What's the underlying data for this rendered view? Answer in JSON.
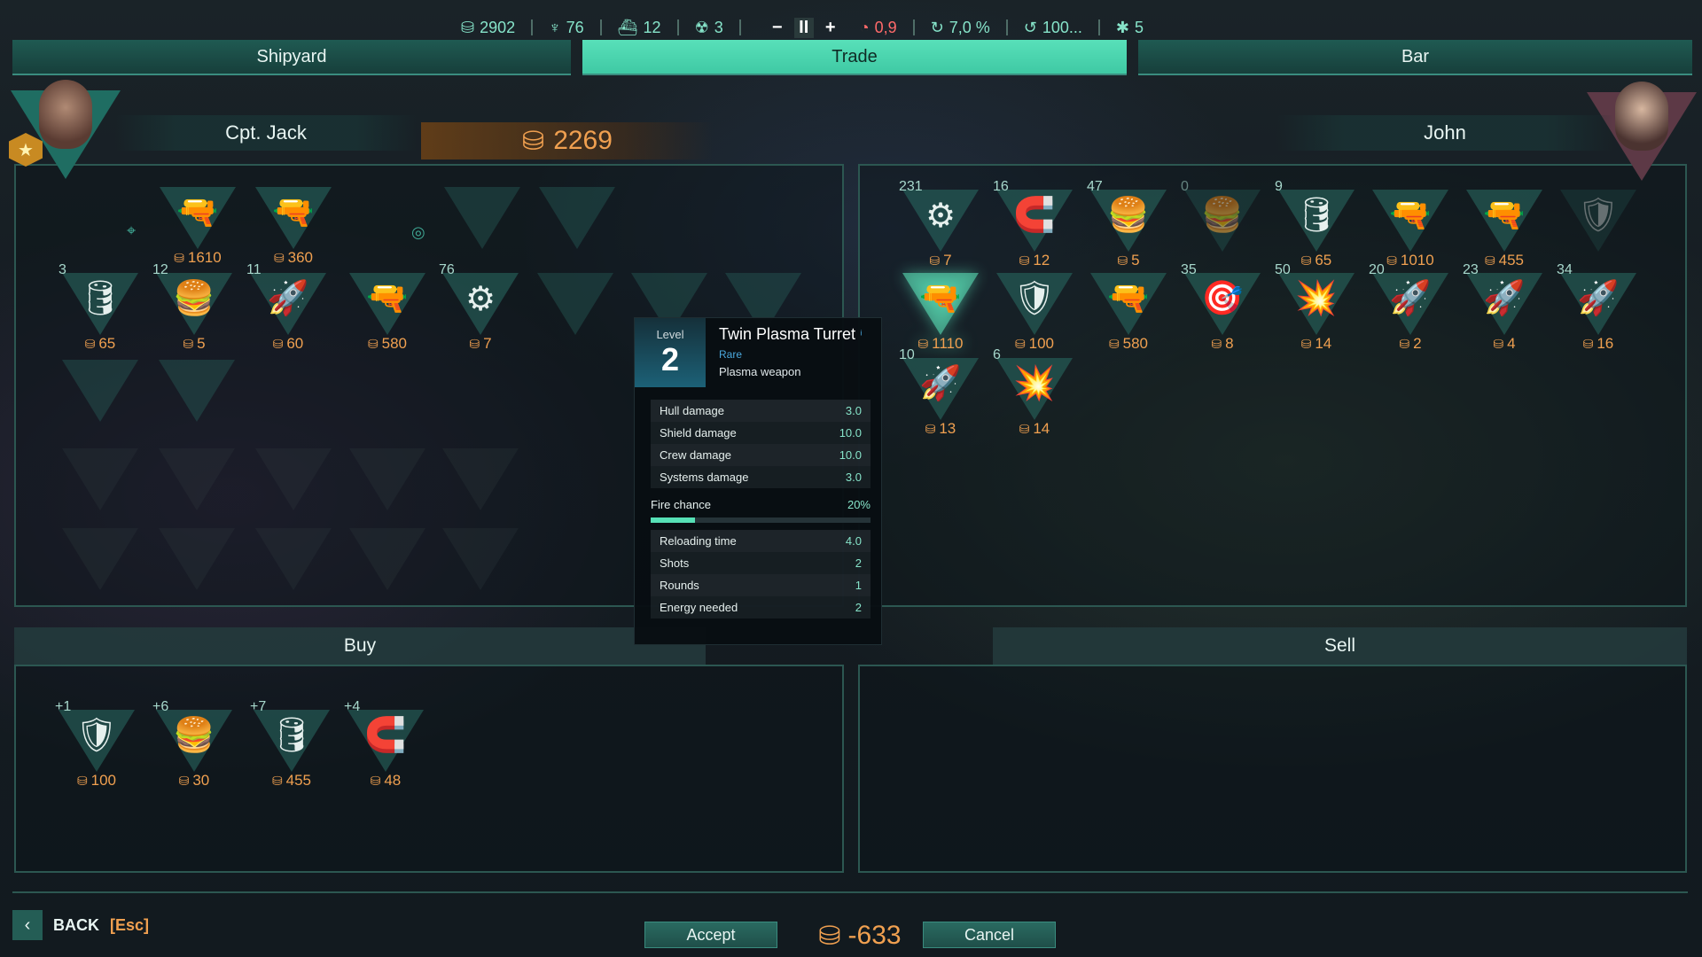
{
  "topbar": {
    "credits": "2902",
    "crew": "76",
    "ships": "12",
    "hazard": "3",
    "minus": "−",
    "pause": "II",
    "plus": "+",
    "danger": "0,9",
    "growth": "7,0 %",
    "progress": "100...",
    "insects": "5"
  },
  "tabs": {
    "shipyard": "Shipyard",
    "trade": "Trade",
    "bar": "Bar"
  },
  "player": {
    "name": "Cpt. Jack",
    "money": "2269"
  },
  "trader": {
    "name": "John"
  },
  "player_equipped": [
    {
      "item": "🔫",
      "price": "1610"
    },
    {
      "item": "🔫",
      "price": "360"
    },
    {
      "item": "",
      "price": ""
    },
    {
      "item": "",
      "price": ""
    }
  ],
  "player_cargo": [
    {
      "qty": "3",
      "item": "🛢",
      "price": "65"
    },
    {
      "qty": "12",
      "item": "🍔",
      "price": "5"
    },
    {
      "qty": "11",
      "item": "🚀",
      "price": "60"
    },
    {
      "qty": "",
      "item": "🔫",
      "price": "580"
    },
    {
      "qty": "76",
      "item": "⚙",
      "price": "7"
    }
  ],
  "trader_items_row1": [
    {
      "qty": "231",
      "item": "⚙",
      "price": "7"
    },
    {
      "qty": "16",
      "item": "🧲",
      "price": "12"
    },
    {
      "qty": "47",
      "item": "🍔",
      "price": "5"
    },
    {
      "qty": "0",
      "item": "🍔",
      "price": ""
    },
    {
      "qty": "9",
      "item": "🛢",
      "price": "65"
    },
    {
      "qty": "",
      "item": "🔫",
      "price": "1010"
    },
    {
      "qty": "",
      "item": "🔫",
      "price": "455"
    },
    {
      "qty": "",
      "item": "🛡",
      "price": ""
    }
  ],
  "trader_items_row2": [
    {
      "qty": "",
      "item": "🔫",
      "price": "1110"
    },
    {
      "qty": "",
      "item": "🛡",
      "price": "100"
    },
    {
      "qty": "",
      "item": "🔫",
      "price": "580"
    },
    {
      "qty": "35",
      "item": "🎯",
      "price": "8"
    },
    {
      "qty": "50",
      "item": "💥",
      "price": "14"
    },
    {
      "qty": "20",
      "item": "🚀",
      "price": "2"
    },
    {
      "qty": "23",
      "item": "🚀",
      "price": "4"
    },
    {
      "qty": "34",
      "item": "🚀",
      "price": "16"
    }
  ],
  "trader_items_row3": [
    {
      "qty": "10",
      "item": "🚀",
      "price": "13"
    },
    {
      "qty": "6",
      "item": "💥",
      "price": "14"
    }
  ],
  "buy_items": [
    {
      "qty": "+1",
      "item": "🛡",
      "price": "100"
    },
    {
      "qty": "+6",
      "item": "🍔",
      "price": "30"
    },
    {
      "qty": "+7",
      "item": "🛢",
      "price": "455"
    },
    {
      "qty": "+4",
      "item": "🧲",
      "price": "48"
    }
  ],
  "sections": {
    "buy": "Buy",
    "sell": "Sell"
  },
  "tooltip": {
    "level_label": "Level",
    "level": "2",
    "name": "Twin Plasma Turret",
    "rarity": "Rare",
    "type": "Plasma weapon",
    "stats": [
      {
        "label": "Hull damage",
        "value": "3.0"
      },
      {
        "label": "Shield damage",
        "value": "10.0"
      },
      {
        "label": "Crew damage",
        "value": "10.0"
      },
      {
        "label": "Systems damage",
        "value": "3.0"
      }
    ],
    "fire_label": "Fire chance",
    "fire_value": "20%",
    "fire_fraction": 0.2,
    "stats2": [
      {
        "label": "Reloading time",
        "value": "4.0"
      },
      {
        "label": "Shots",
        "value": "2"
      },
      {
        "label": "Rounds",
        "value": "1"
      },
      {
        "label": "Energy needed",
        "value": "2"
      }
    ]
  },
  "bottom": {
    "back_label": "BACK",
    "back_key": "[Esc]",
    "accept": "Accept",
    "balance": "-633",
    "cancel": "Cancel"
  },
  "colors": {
    "accent": "#58e0b9",
    "money": "#f0a050",
    "panel_border": "#2c5751"
  }
}
